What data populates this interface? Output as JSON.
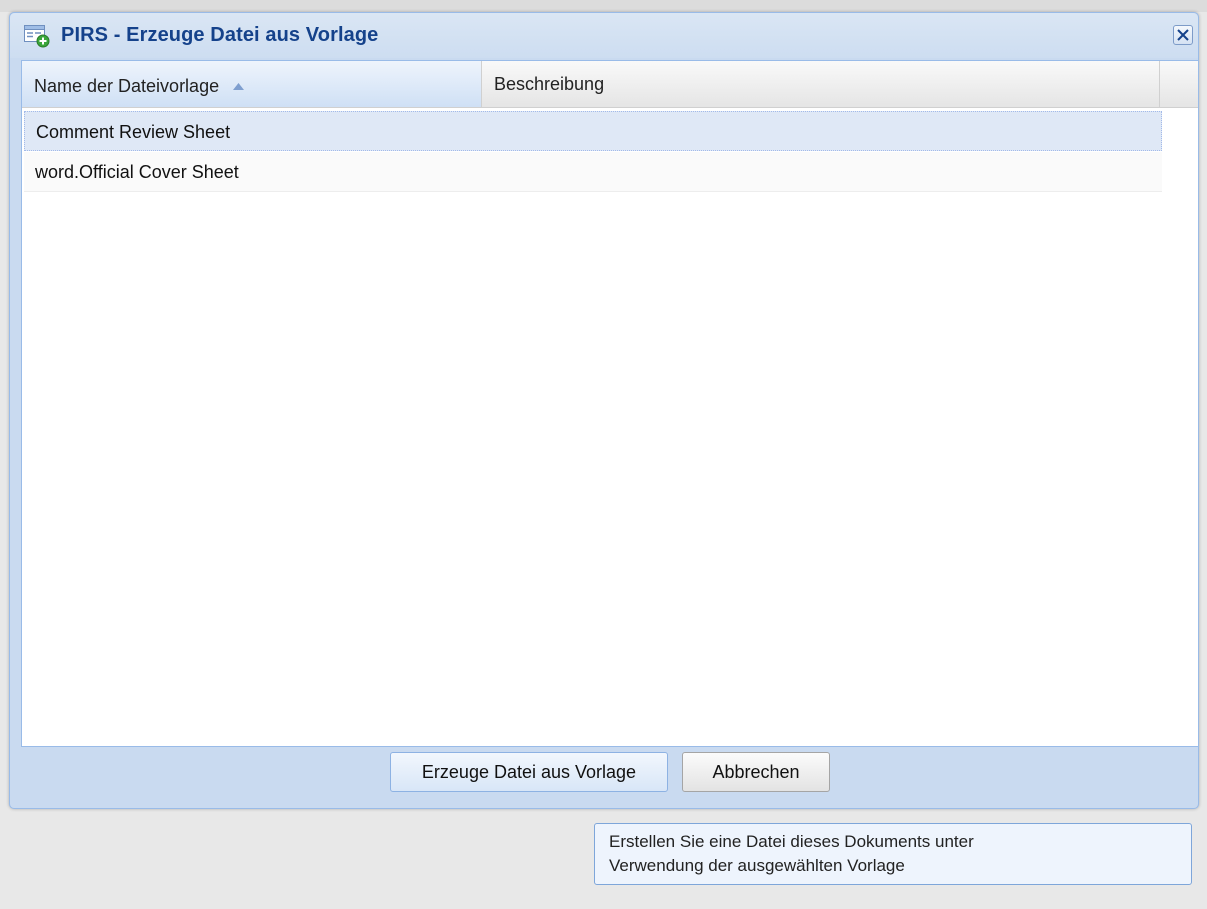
{
  "window": {
    "title": "PIRS - Erzeuge Datei aus Vorlage",
    "close_icon": "close-icon",
    "title_icon": "new-file-window-icon"
  },
  "grid": {
    "columns": [
      "Name der Dateivorlage",
      "Beschreibung"
    ],
    "sort": {
      "column": "Name der Dateivorlage",
      "direction": "ascending"
    },
    "rows": [
      {
        "name": "Comment Review Sheet",
        "description": "",
        "selected": true
      },
      {
        "name": "word.Official Cover Sheet",
        "description": "",
        "selected": false
      }
    ]
  },
  "buttons": {
    "create": "Erzeuge Datei aus Vorlage",
    "cancel": "Abbrechen"
  },
  "tooltip": {
    "line1": "Erstellen Sie eine Datei dieses Dokuments unter",
    "line2": "Verwendung der ausgewählten Vorlage"
  },
  "colors": {
    "title_text": "#15428b",
    "window_frame": "#c9daf0",
    "selected_row": "#dfe8f6"
  }
}
